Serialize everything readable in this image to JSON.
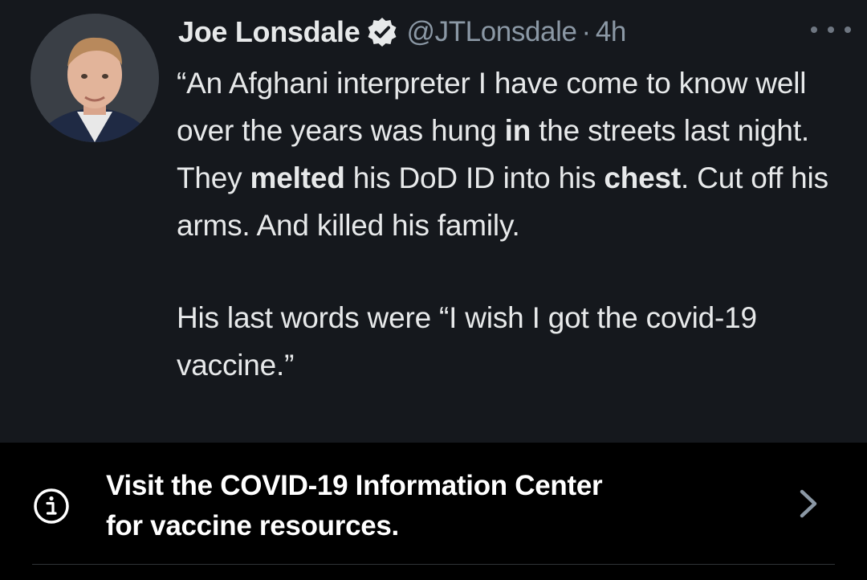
{
  "tweet": {
    "author": {
      "display_name": "Joe Lonsdale",
      "handle": "@JTLonsdale",
      "separator": "·",
      "time": "4h",
      "verified_icon": "verified-badge-icon"
    },
    "body": {
      "l1_a": "“An Afghani interpreter I have come to know well over the years was hung ",
      "l1_b": "in",
      "l1_c": " the streets last night. They ",
      "l1_d": "melted",
      "l1_e": " his DoD ID into his ",
      "l1_f": "chest",
      "l1_g": ". Cut off his arms. And killed his family.",
      "p2": "His last words were “I wish I got the covid-19 vaccine.”"
    },
    "more_icon": "more-horizontal-icon"
  },
  "info_banner": {
    "line1": "Visit the COVID-19 Information Center",
    "line2": "for vaccine resources.",
    "icon": "info-icon",
    "chevron": "chevron-right-icon"
  },
  "colors": {
    "tweet_bg": "#15181d",
    "banner_bg": "#000000",
    "text": "#e7e9ea",
    "secondary": "#8b98a5"
  }
}
